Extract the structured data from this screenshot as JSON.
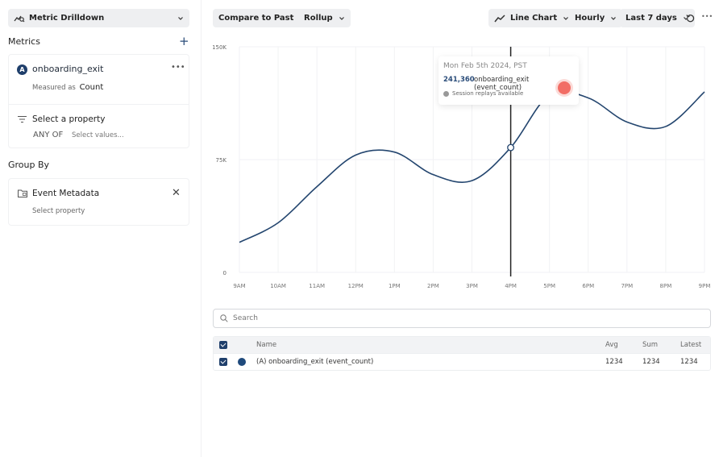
{
  "sidebar": {
    "view_selector": {
      "label": "Metric Drilldown",
      "icon": "metric-drilldown-icon"
    },
    "metrics_title": "Metrics",
    "add_metric_icon": "plus-icon",
    "metric": {
      "badge": "A",
      "name": "onboarding_exit",
      "measured_prefix": "Measured as",
      "measured_value": "Count",
      "filter": {
        "title": "Select a property",
        "operator": "ANY OF",
        "values_placeholder": "Select values..."
      }
    },
    "group_by_title": "Group By",
    "group_by": {
      "name": "Event Metadata",
      "sub": "Select property"
    }
  },
  "toolbar": {
    "compare": "Compare to Past",
    "rollup": "Rollup",
    "chart_type": "Line Chart",
    "granularity": "Hourly",
    "range": "Last 7 days",
    "refresh_icon": "refresh-icon",
    "more_icon": "more-icon"
  },
  "tooltip": {
    "date": "Mon Feb 5th 2024, PST",
    "value": "241,360",
    "label": "onboarding_exit (event_count)",
    "replay": "Session replays available"
  },
  "search": {
    "placeholder": "Search",
    "value": ""
  },
  "table": {
    "headers": {
      "name": "Name",
      "avg": "Avg",
      "sum": "Sum",
      "latest": "Latest"
    },
    "rows": [
      {
        "name": "(A) onboarding_exit (event_count)",
        "avg": "1234",
        "sum": "1234",
        "latest": "1234",
        "color": "#1f4a7c"
      }
    ]
  },
  "colors": {
    "accent": "#1f3f6b",
    "line": "#24466f",
    "hover": "#f26d65"
  },
  "chart_data": {
    "type": "line",
    "title": "",
    "xlabel": "",
    "ylabel": "",
    "x": [
      "9AM",
      "10AM",
      "11AM",
      "12PM",
      "1PM",
      "2PM",
      "3PM",
      "4PM",
      "5PM",
      "6PM",
      "7PM",
      "8PM",
      "9PM"
    ],
    "y_ticks": [
      "0",
      "75K",
      "150K"
    ],
    "ylim": [
      0,
      150000
    ],
    "grid": true,
    "series": [
      {
        "name": "onboarding_exit (event_count)",
        "values": [
          20000,
          33000,
          57000,
          78000,
          80000,
          65000,
          61000,
          83000,
          118000,
          116000,
          100000,
          97000,
          120000
        ]
      }
    ],
    "hover_x": "4PM"
  }
}
